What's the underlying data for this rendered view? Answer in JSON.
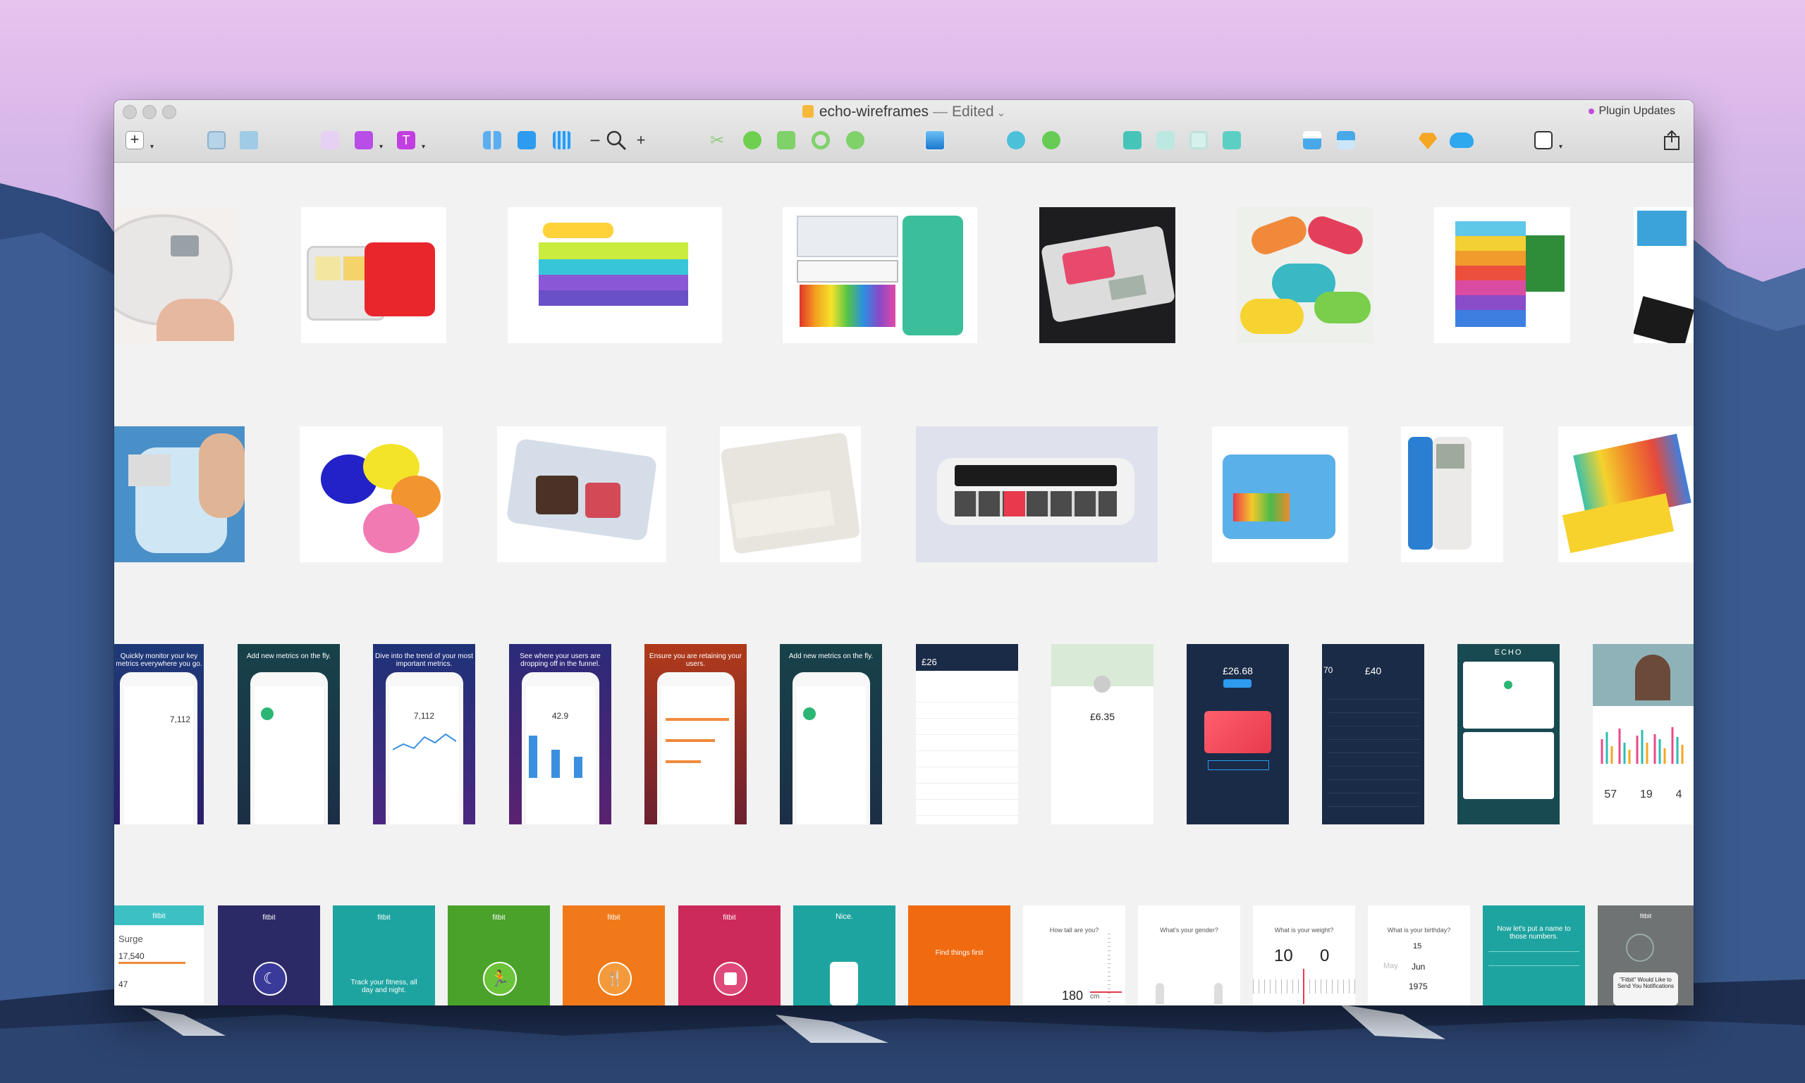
{
  "window": {
    "document_name": "echo-wireframes",
    "separator": "—",
    "status": "Edited",
    "plugin_updates_label": "Plugin Updates"
  },
  "toolbar": {
    "icons": [
      "add-icon",
      "group-icon",
      "ungroup-icon",
      "rotate-icon",
      "transform-icon",
      "text-icon",
      "grid-view-icon",
      "grid-icon",
      "columns-icon",
      "zoom-out-icon",
      "zoom-icon",
      "zoom-in-icon",
      "scissors-icon",
      "mask-icon",
      "scale-icon",
      "flip-icon",
      "edit-shape-icon",
      "image-icon",
      "union-icon",
      "subtract-icon",
      "move-forward-icon",
      "move-backward-icon",
      "bring-front-icon",
      "send-back-icon",
      "export-icon",
      "align-icon",
      "sketch-icon",
      "cloud-icon",
      "view-icon",
      "share-icon"
    ],
    "zoom_out_label": "−",
    "zoom_in_label": "+",
    "add_label": "+"
  },
  "colors": {
    "plugin_dot": "#c44be0",
    "toolbar_green": "#4bd06a",
    "toolbar_purple": "#b84de8",
    "toolbar_blue": "#2d9bf0",
    "toolbar_teal": "#3dc6c0",
    "toolbar_orange": "#f5a623"
  },
  "canvas": {
    "row3_texts": {
      "s1": "Quickly monitor your key metrics everywhere you go.",
      "s2": "Add new metrics on the fly.",
      "s3": "Dive into the trend of your most important metrics.",
      "s4": "See where your users are dropping off in the funnel.",
      "s5": "Ensure you are retaining your users.",
      "s6": "Add new metrics on the fly.",
      "n1": "7,112",
      "n2": "7,112",
      "n3": "42.9",
      "m1_amount": "£26",
      "m2_amount": "£6.35",
      "m3_amount": "£26.68",
      "m4_amount": "£40",
      "m4_label": "70",
      "echo_logo": "ECHO",
      "stats": [
        "57",
        "19",
        "4"
      ]
    },
    "row4_texts": {
      "brand": "fitbit",
      "surge": "Surge",
      "steps": "17,540",
      "bpm": "47",
      "track": "Track your fitness, all day and night.",
      "find": "Find things first",
      "height_q": "How tall are you?",
      "height_val": "180",
      "height_unit": "cm",
      "gender_q": "What's your gender?",
      "weight_q": "What is your weight?",
      "weight_st": "10",
      "weight_lb": "0",
      "bday_q": "What is your birthday?",
      "bday_d": "15",
      "bday_m": "Jun",
      "bday_y": "1975",
      "bday_m_prev": "May",
      "names_q": "Now let's put a name to those numbers.",
      "notify": "\"Fitbit\" Would Like to Send You Notifications",
      "nice": "Nice."
    }
  }
}
